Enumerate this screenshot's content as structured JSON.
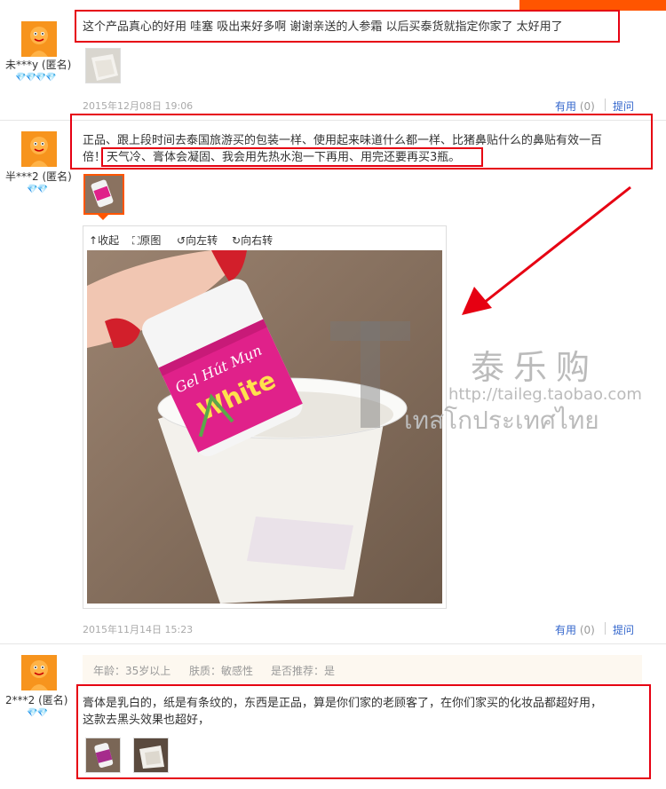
{
  "reviews": [
    {
      "user": "未***y (匿名)",
      "hearts": "💎💎💎💎",
      "text": "这个产品真心的好用 哇塞 吸出来好多啊 谢谢亲送的人参霜 以后买泰货就指定你家了 太好用了",
      "date": "2015年12月08日 19:06",
      "useful_label": "有用",
      "useful_count": "(0)",
      "ask_label": "提问"
    },
    {
      "user": "半***2 (匿名)",
      "hearts": "💎💎",
      "text_line1": "正品、跟上段时间去泰国旅游买的包装一样、使用起来味道什么都一样、比猪鼻贴什么的鼻贴有效一百",
      "text_line2_start": "倍！",
      "text_line2_highlight": "天气冷、膏体会凝固、我会用先热水泡一下再用、用完还要再买3瓶。",
      "date": "2015年11月14日 15:23",
      "useful_label": "有用",
      "useful_count": "(0)",
      "ask_label": "提问",
      "viewer": {
        "collapse": "收起",
        "original": "原图",
        "rotate_left": "向左转",
        "rotate_right": "向右转"
      },
      "product_label_1": "Gel Hút Mụn",
      "product_label_2": "White"
    },
    {
      "user": "2***2 (匿名)",
      "hearts": "💎💎",
      "age_label": "年龄：35岁以上",
      "skin_label": "肤质：敏感性",
      "recommend_label": "是否推荐：是",
      "text_line1": "膏体是乳白的，纸是有条纹的，东西是正品，算是你们家的老顾客了，在你们家买的化妆品都超好用，",
      "text_line2": "这款去黑头效果也超好，"
    }
  ],
  "watermark": {
    "brand": "泰乐购",
    "url": "http://taileg.taobao.com",
    "thai": "เทสโกประเทศไทย"
  },
  "colors": {
    "highlight_red": "#e60012",
    "link_blue": "#3366cc",
    "avatar_orange": "#f7941d"
  }
}
